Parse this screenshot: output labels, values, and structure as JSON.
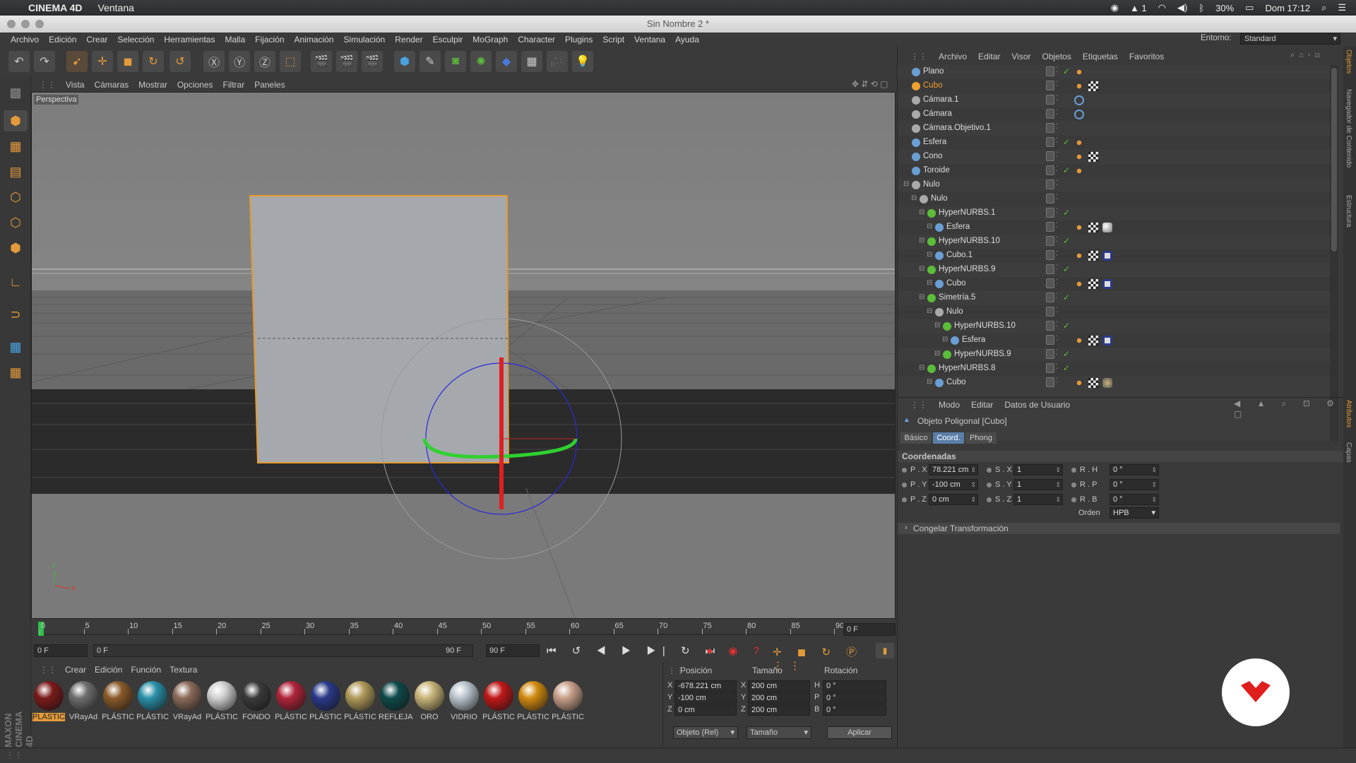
{
  "mac_menubar": {
    "app_name": "CINEMA 4D",
    "menu": "Ventana",
    "battery": "30%",
    "clock": "Dom 17:12"
  },
  "window": {
    "title": "Sin Nombre 2 *"
  },
  "menu": [
    "Archivo",
    "Edición",
    "Crear",
    "Selección",
    "Herramientas",
    "Malla",
    "Fijación",
    "Animación",
    "Simulación",
    "Render",
    "Esculpir",
    "MoGraph",
    "Character",
    "Plugins",
    "Script",
    "Ventana",
    "Ayuda"
  ],
  "environment": {
    "label": "Entorno:",
    "value": "Standard"
  },
  "viewport": {
    "menu": [
      "Vista",
      "Cámaras",
      "Mostrar",
      "Opciones",
      "Filtrar",
      "Paneles"
    ],
    "label": "Perspectiva"
  },
  "timeline": {
    "ticks": [
      "0",
      "5",
      "10",
      "15",
      "20",
      "25",
      "30",
      "35",
      "40",
      "45",
      "50",
      "55",
      "60",
      "65",
      "70",
      "75",
      "80",
      "85",
      "90"
    ],
    "current_frame": "0 F",
    "start": "0 F",
    "range_start": "0 F",
    "range_end": "90 F",
    "end": "90 F"
  },
  "materials": {
    "menu": [
      "Crear",
      "Edición",
      "Función",
      "Textura"
    ],
    "items": [
      {
        "label": "PLÁSTIC",
        "color": "#7a1a1a",
        "selected": true
      },
      {
        "label": "VRayAd",
        "color": "#6e6e6e"
      },
      {
        "label": "PLÁSTIC",
        "color": "#8a5a2a"
      },
      {
        "label": "PLÁSTIC",
        "color": "#2a8fa8"
      },
      {
        "label": "VRayAd",
        "color": "#8a6a5a"
      },
      {
        "label": "PLÁSTIC",
        "color": "#cfcfcf"
      },
      {
        "label": "FONDO",
        "color": "#3a3a3a"
      },
      {
        "label": "PLÁSTIC",
        "color": "#b0243a"
      },
      {
        "label": "PLÁSTIC",
        "color": "#2a3a8a"
      },
      {
        "label": "PLÁSTIC",
        "color": "#b09a5a"
      },
      {
        "label": "REFLEJA",
        "color": "#0f4a4a"
      },
      {
        "label": "ORO",
        "color": "#c8b478"
      },
      {
        "label": "VIDRIO",
        "color": "#b8c4cc"
      },
      {
        "label": "PLÁSTIC",
        "color": "#c01818"
      },
      {
        "label": "PLÁSTIC",
        "color": "#d08a10"
      },
      {
        "label": "PLÁSTIC",
        "color": "#c8a08a"
      }
    ]
  },
  "coords_manager": {
    "headers": [
      "Posición",
      "Tamaño",
      "Rotación"
    ],
    "rows": [
      {
        "axis": "X",
        "pos": "-678.221 cm",
        "size_axis": "X",
        "size": "200 cm",
        "rot_axis": "H",
        "rot": "0 °"
      },
      {
        "axis": "Y",
        "pos": "-100 cm",
        "size_axis": "Y",
        "size": "200 cm",
        "rot_axis": "P",
        "rot": "0 °"
      },
      {
        "axis": "Z",
        "pos": "0 cm",
        "size_axis": "Z",
        "size": "200 cm",
        "rot_axis": "B",
        "rot": "0 °"
      }
    ],
    "mode": "Objeto (Rel)",
    "size_mode": "Tamaño",
    "apply": "Aplicar"
  },
  "object_manager": {
    "menu": [
      "Archivo",
      "Editar",
      "Visor",
      "Objetos",
      "Etiquetas",
      "Favoritos"
    ],
    "objects": [
      {
        "name": "Plano",
        "depth": 0,
        "color": "#6a9fd4",
        "check": true,
        "tags": [
          "dot"
        ]
      },
      {
        "name": "Cubo",
        "depth": 0,
        "color": "#f0a030",
        "check": false,
        "tags": [
          "dot",
          "checker"
        ],
        "selected": true
      },
      {
        "name": "Cámara.1",
        "depth": 0,
        "color": "#aaa",
        "check": false,
        "tags": [
          "target"
        ]
      },
      {
        "name": "Cámara",
        "depth": 0,
        "color": "#aaa",
        "check": false,
        "tags": [
          "target"
        ]
      },
      {
        "name": "Cámara.Objetivo.1",
        "depth": 0,
        "color": "#aaa",
        "check": false,
        "tags": []
      },
      {
        "name": "Esfera",
        "depth": 0,
        "color": "#6a9fd4",
        "check": true,
        "tags": [
          "dot"
        ]
      },
      {
        "name": "Cono",
        "depth": 0,
        "color": "#6a9fd4",
        "check": false,
        "tags": [
          "dot",
          "checker"
        ]
      },
      {
        "name": "Toroide",
        "depth": 0,
        "color": "#6a9fd4",
        "check": true,
        "tags": [
          "dot"
        ]
      },
      {
        "name": "Nulo",
        "depth": 0,
        "color": "#aaa",
        "check": false,
        "tags": []
      },
      {
        "name": "Nulo",
        "depth": 1,
        "color": "#aaa",
        "check": false,
        "tags": []
      },
      {
        "name": "HyperNURBS.1",
        "depth": 2,
        "color": "#5cbd3a",
        "check": true,
        "tags": []
      },
      {
        "name": "Esfera",
        "depth": 3,
        "color": "#6a9fd4",
        "check": false,
        "tags": [
          "dot",
          "checker",
          "sphere"
        ]
      },
      {
        "name": "HyperNURBS.10",
        "depth": 2,
        "color": "#5cbd3a",
        "check": true,
        "tags": []
      },
      {
        "name": "Cubo.1",
        "depth": 3,
        "color": "#6a9fd4",
        "check": false,
        "tags": [
          "dot",
          "checker",
          "ring"
        ]
      },
      {
        "name": "HyperNURBS.9",
        "depth": 2,
        "color": "#5cbd3a",
        "check": true,
        "tags": []
      },
      {
        "name": "Cubo",
        "depth": 3,
        "color": "#6a9fd4",
        "check": false,
        "tags": [
          "dot",
          "checker",
          "ring"
        ]
      },
      {
        "name": "Simetría.5",
        "depth": 2,
        "color": "#5cbd3a",
        "check": true,
        "tags": []
      },
      {
        "name": "Nulo",
        "depth": 3,
        "color": "#aaa",
        "check": false,
        "tags": []
      },
      {
        "name": "HyperNURBS.10",
        "depth": 4,
        "color": "#5cbd3a",
        "check": true,
        "tags": []
      },
      {
        "name": "Esfera",
        "depth": 5,
        "color": "#6a9fd4",
        "check": false,
        "tags": [
          "dot",
          "checker",
          "ring"
        ]
      },
      {
        "name": "HyperNURBS.9",
        "depth": 4,
        "color": "#5cbd3a",
        "check": true,
        "tags": []
      },
      {
        "name": "HyperNURBS.8",
        "depth": 2,
        "color": "#5cbd3a",
        "check": true,
        "tags": []
      },
      {
        "name": "Cubo",
        "depth": 3,
        "color": "#6a9fd4",
        "check": false,
        "tags": [
          "dot",
          "checker",
          "gold"
        ]
      }
    ]
  },
  "attributes": {
    "menu": [
      "Modo",
      "Editar",
      "Datos de Usuario"
    ],
    "object_label": "Objeto Poligonal [Cubo]",
    "tabs": [
      {
        "label": "Básico",
        "active": false
      },
      {
        "label": "Coord.",
        "active": true
      },
      {
        "label": "Phong",
        "active": false
      }
    ],
    "section": "Coordenadas",
    "rows": [
      {
        "p_label": "P . X",
        "p": "78.221 cm",
        "s_label": "S . X",
        "s": "1",
        "r_label": "R . H",
        "r": "0 °"
      },
      {
        "p_label": "P . Y",
        "p": "-100 cm",
        "s_label": "S . Y",
        "s": "1",
        "r_label": "R . P",
        "r": "0 °"
      },
      {
        "p_label": "P . Z",
        "p": "0 cm",
        "s_label": "S . Z",
        "s": "1",
        "r_label": "R . B",
        "r": "0 °"
      }
    ],
    "order_label": "Orden",
    "order_value": "HPB",
    "freeze": "Congelar Transformación"
  },
  "side_tabs": [
    "Objetos",
    "Navegador de Contenido",
    "Estructura",
    "Atributos",
    "Capas"
  ],
  "brand": "MAXON CINEMA 4D"
}
